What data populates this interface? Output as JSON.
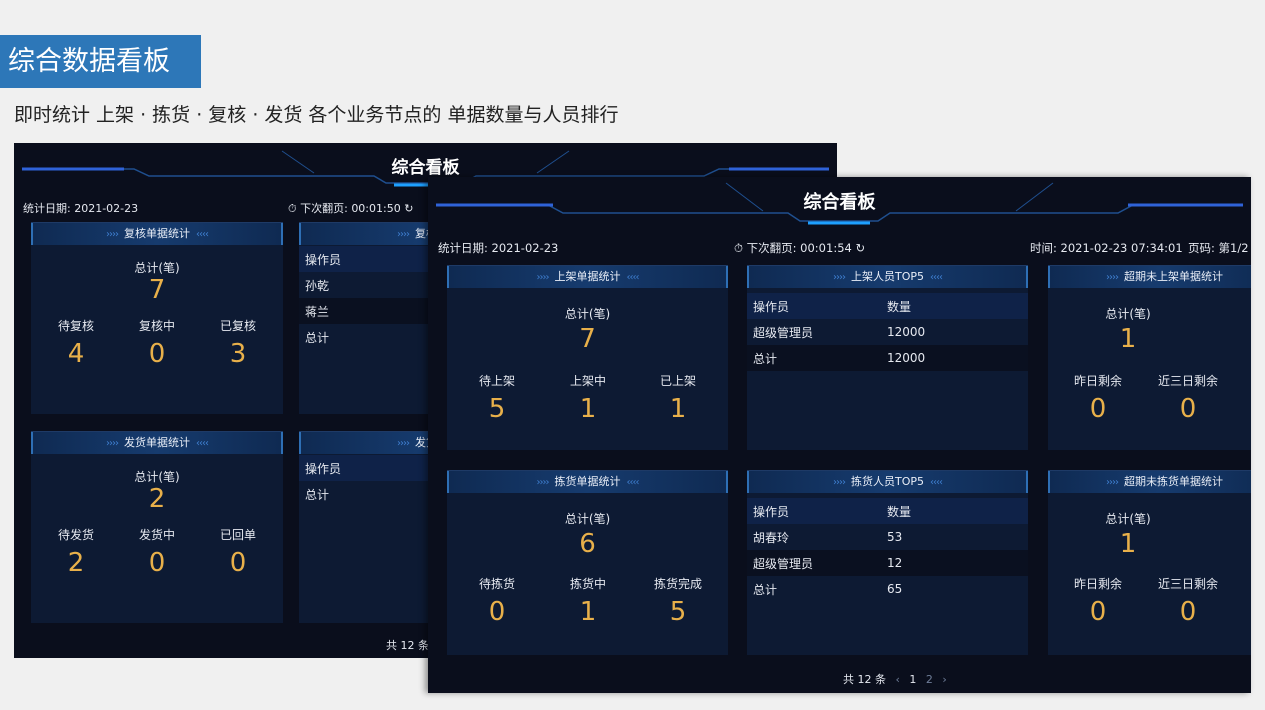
{
  "page": {
    "badge": "综合数据看板",
    "subtitle": "即时统计 上架 · 拣货 · 复核 · 发货  各个业务节点的 单据数量与人员排行"
  },
  "back": {
    "title": "综合看板",
    "date_label": "统计日期:",
    "date_value": "2021-02-23",
    "next_label": "下次翻页:",
    "next_value": "00:01:50",
    "review_card": {
      "title": "复核单据统计",
      "total_label": "总计(笔)",
      "total": "7",
      "s1_label": "待复核",
      "s1": "4",
      "s2_label": "复核中",
      "s2": "0",
      "s3_label": "已复核",
      "s3": "3"
    },
    "review_staff": {
      "title": "复核人员",
      "head": "操作员",
      "rows": [
        "孙乾",
        "蒋兰",
        "总计"
      ]
    },
    "ship_card": {
      "title": "发货单据统计",
      "total_label": "总计(笔)",
      "total": "2",
      "s1_label": "待发货",
      "s1": "2",
      "s2_label": "发货中",
      "s2": "0",
      "s3_label": "已回单",
      "s3": "0"
    },
    "ship_staff": {
      "title": "发货人员",
      "head": "操作员",
      "rows": [
        "总计"
      ]
    },
    "pager_total": "共 12 条"
  },
  "front": {
    "title": "综合看板",
    "date_label": "统计日期:",
    "date_value": "2021-02-23",
    "next_label": "下次翻页:",
    "next_value": "00:01:54",
    "time_label": "时间:",
    "time_value": "2021-02-23 07:34:01",
    "page_label": "页码:",
    "page_value": "第1/2",
    "shelf_card": {
      "title": "上架单据统计",
      "total_label": "总计(笔)",
      "total": "7",
      "s1_label": "待上架",
      "s1": "5",
      "s2_label": "上架中",
      "s2": "1",
      "s3_label": "已上架",
      "s3": "1"
    },
    "shelf_top": {
      "title": "上架人员TOP5",
      "col1": "操作员",
      "col2": "数量",
      "rows": [
        {
          "name": "超级管理员",
          "qty": "12000"
        },
        {
          "name": "总计",
          "qty": "12000"
        }
      ]
    },
    "overdue_shelf": {
      "title": "超期未上架单据统计",
      "total_label": "总计(笔)",
      "total": "1",
      "s1_label": "昨日剩余",
      "s1": "0",
      "s2_label": "近三日剩余",
      "s2": "0"
    },
    "pick_card": {
      "title": "拣货单据统计",
      "total_label": "总计(笔)",
      "total": "6",
      "s1_label": "待拣货",
      "s1": "0",
      "s2_label": "拣货中",
      "s2": "1",
      "s3_label": "拣货完成",
      "s3": "5"
    },
    "pick_top": {
      "title": "拣货人员TOP5",
      "col1": "操作员",
      "col2": "数量",
      "rows": [
        {
          "name": "胡春玲",
          "qty": "53"
        },
        {
          "name": "超级管理员",
          "qty": "12"
        },
        {
          "name": "总计",
          "qty": "65"
        }
      ]
    },
    "overdue_pick": {
      "title": "超期未拣货单据统计",
      "total_label": "总计(笔)",
      "total": "1",
      "s1_label": "昨日剩余",
      "s1": "0",
      "s2_label": "近三日剩余",
      "s2": "0"
    },
    "pager_total": "共 12 条",
    "pager_prev": "‹",
    "pager_p1": "1",
    "pager_p2": "2",
    "pager_next": "›"
  },
  "colors": {
    "accent": "#e8b04a",
    "badge": "#2d77b8",
    "panel": "#0d1a33",
    "bg": "#0a0e1c"
  },
  "icons": {
    "timer": "stopwatch-icon",
    "refresh": "refresh-icon",
    "chevrons": "double-chevron-icon"
  }
}
